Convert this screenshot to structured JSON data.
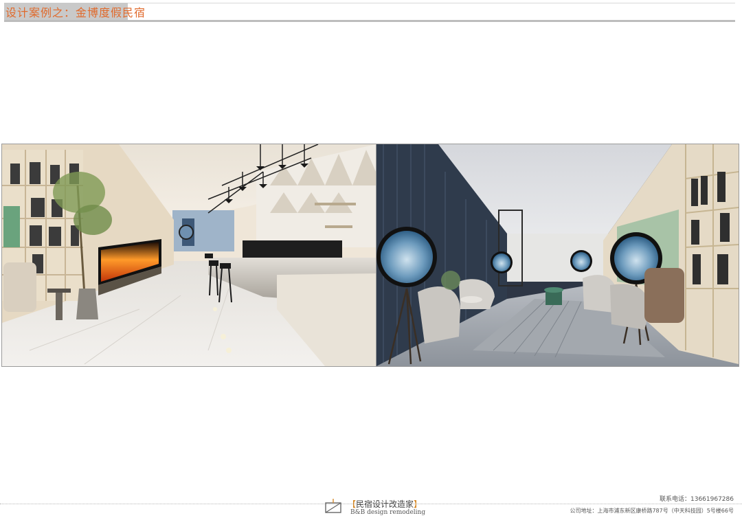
{
  "header": {
    "title": "设计案例之：金博度假民宿"
  },
  "images": {
    "left": "lobby-reception-render",
    "right": "lounge-library-render"
  },
  "footer": {
    "logo_cn_open": "【",
    "logo_cn": "民宿设计改造家",
    "logo_cn_close": "】",
    "logo_en": "B&B design remodeling",
    "phone_label": "联系电话：",
    "phone": "13661967286",
    "address_label": "公司地址：",
    "address": "上海市浦东新区康桥路787号（中天科技园）5号楼66号"
  },
  "colors": {
    "title": "#e06a2c",
    "title_bg": "#c9c9c9",
    "logo_bracket": "#d68a2a"
  }
}
